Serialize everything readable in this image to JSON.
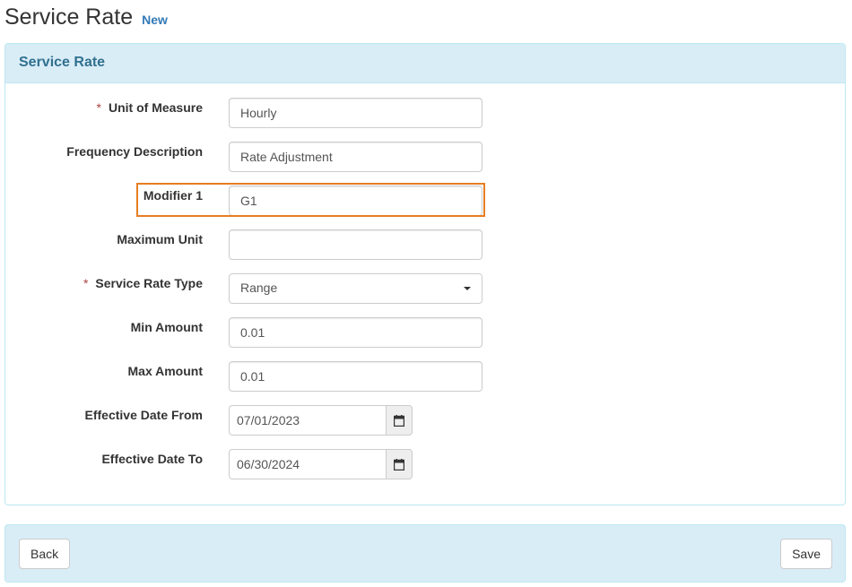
{
  "header": {
    "title": "Service Rate",
    "badge": "New"
  },
  "panel": {
    "title": "Service Rate"
  },
  "form": {
    "unit_of_measure": {
      "label": "Unit of Measure",
      "required": "*",
      "value": "Hourly"
    },
    "frequency_description": {
      "label": "Frequency Description",
      "value": "Rate Adjustment"
    },
    "modifier_1": {
      "label": "Modifier 1",
      "value": "G1"
    },
    "maximum_unit": {
      "label": "Maximum Unit",
      "value": ""
    },
    "service_rate_type": {
      "label": "Service Rate Type",
      "required": "*",
      "value": "Range"
    },
    "min_amount": {
      "label": "Min Amount",
      "value": "0.01"
    },
    "max_amount": {
      "label": "Max Amount",
      "value": "0.01"
    },
    "effective_date_from": {
      "label": "Effective Date From",
      "value": "07/01/2023"
    },
    "effective_date_to": {
      "label": "Effective Date To",
      "value": "06/30/2024"
    }
  },
  "footer": {
    "back_label": "Back",
    "save_label": "Save"
  },
  "colors": {
    "accent": "#31708f",
    "panel_bg": "#d9edf7",
    "highlight": "#e67e22",
    "required": "#a94442",
    "link": "#337ab7"
  },
  "icons": {
    "calendar": "calendar-icon",
    "dropdown": "chevron-down-icon"
  }
}
